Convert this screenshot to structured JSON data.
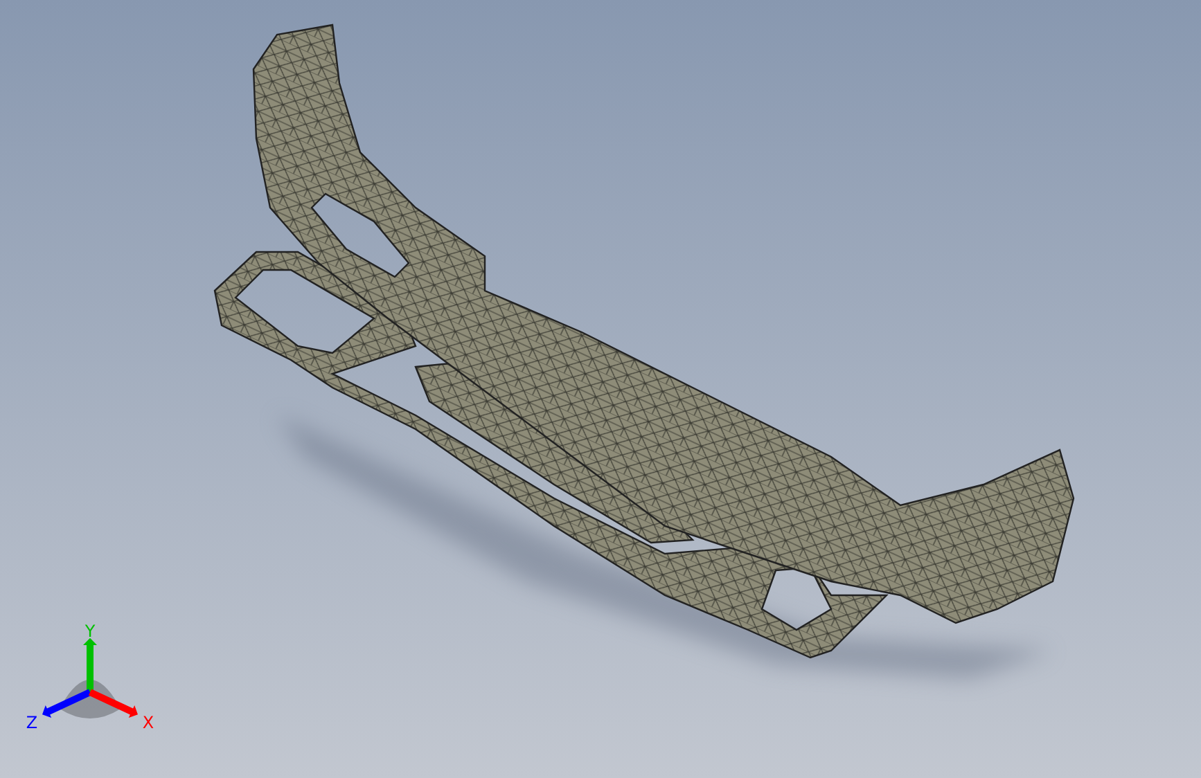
{
  "viewport": {
    "model": {
      "kind": "mesh"
    },
    "triad": {
      "axes": [
        {
          "label": "Y",
          "kind": "up",
          "color": "#00c000"
        },
        {
          "label": "Z",
          "kind": "left",
          "color": "#0000ff"
        },
        {
          "label": "X",
          "kind": "right",
          "color": "#ff0000"
        }
      ]
    }
  }
}
